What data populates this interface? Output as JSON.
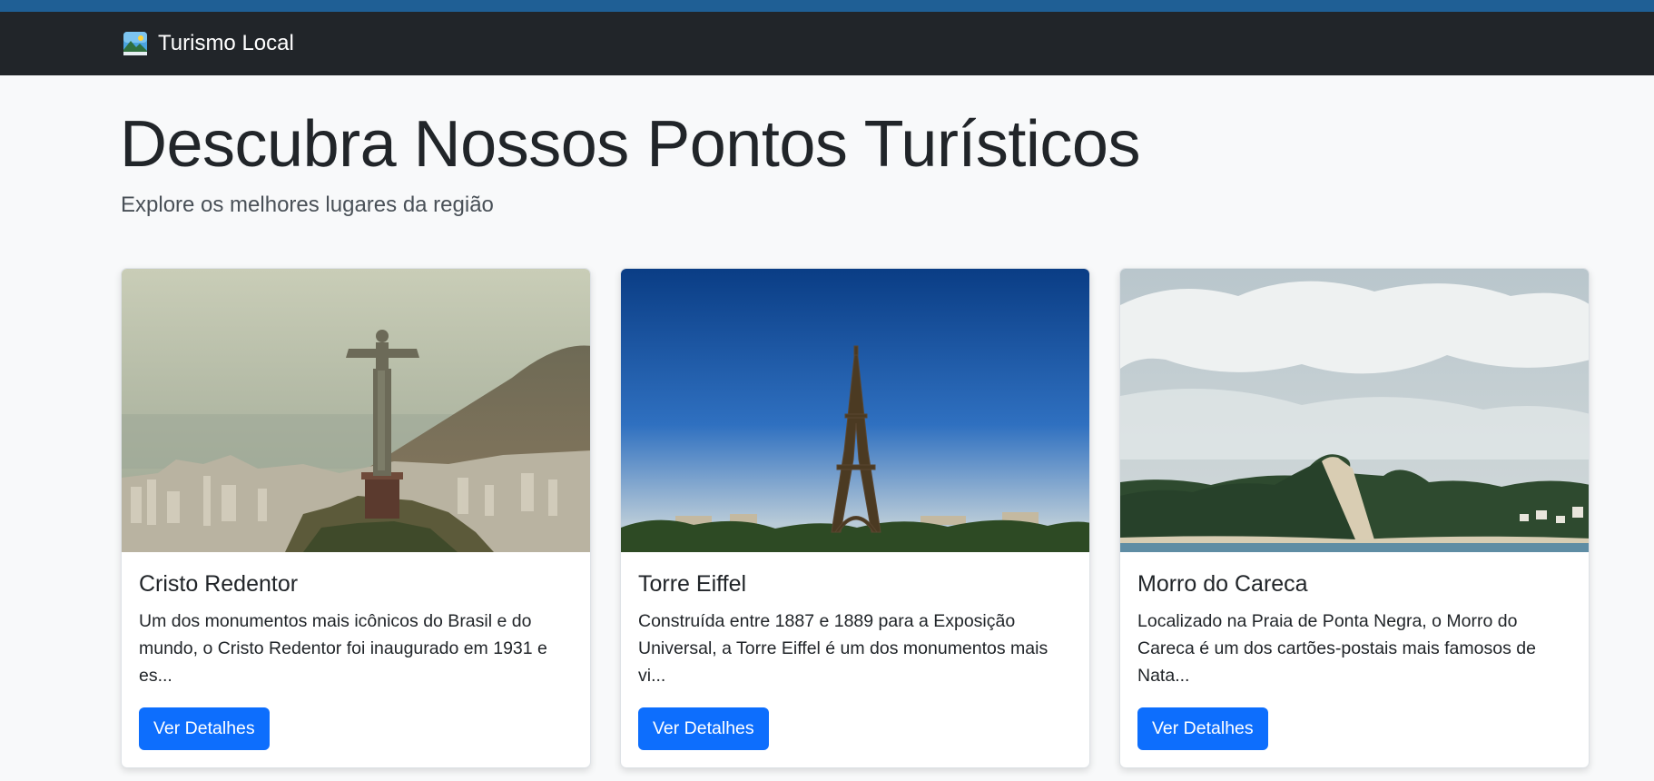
{
  "navbar": {
    "brand_name": "Turismo Local",
    "brand_icon": "landscape-icon",
    "background": "#212529"
  },
  "hero": {
    "title": "Descubra Nossos Pontos Turísticos",
    "subtitle": "Explore os melhores lugares da região"
  },
  "cards": [
    {
      "title": "Cristo Redentor",
      "description": "Um dos monumentos mais icônicos do Brasil e do mundo, o Cristo Redentor foi inaugurado em 1931 e es...",
      "button_label": "Ver Detalhes",
      "image": "christ-the-redeemer-photo"
    },
    {
      "title": "Torre Eiffel",
      "description": "Construída entre 1887 e 1889 para a Exposição Universal, a Torre Eiffel é um dos monumentos mais vi...",
      "button_label": "Ver Detalhes",
      "image": "eiffel-tower-photo"
    },
    {
      "title": "Morro do Careca",
      "description": "Localizado na Praia de Ponta Negra, o Morro do Careca é um dos cartões-postais mais famosos de Nata...",
      "button_label": "Ver Detalhes",
      "image": "morro-do-careca-photo"
    }
  ],
  "colors": {
    "primary_button": "#0d6efd",
    "page_background": "#f8f9fa",
    "text": "#212529"
  }
}
